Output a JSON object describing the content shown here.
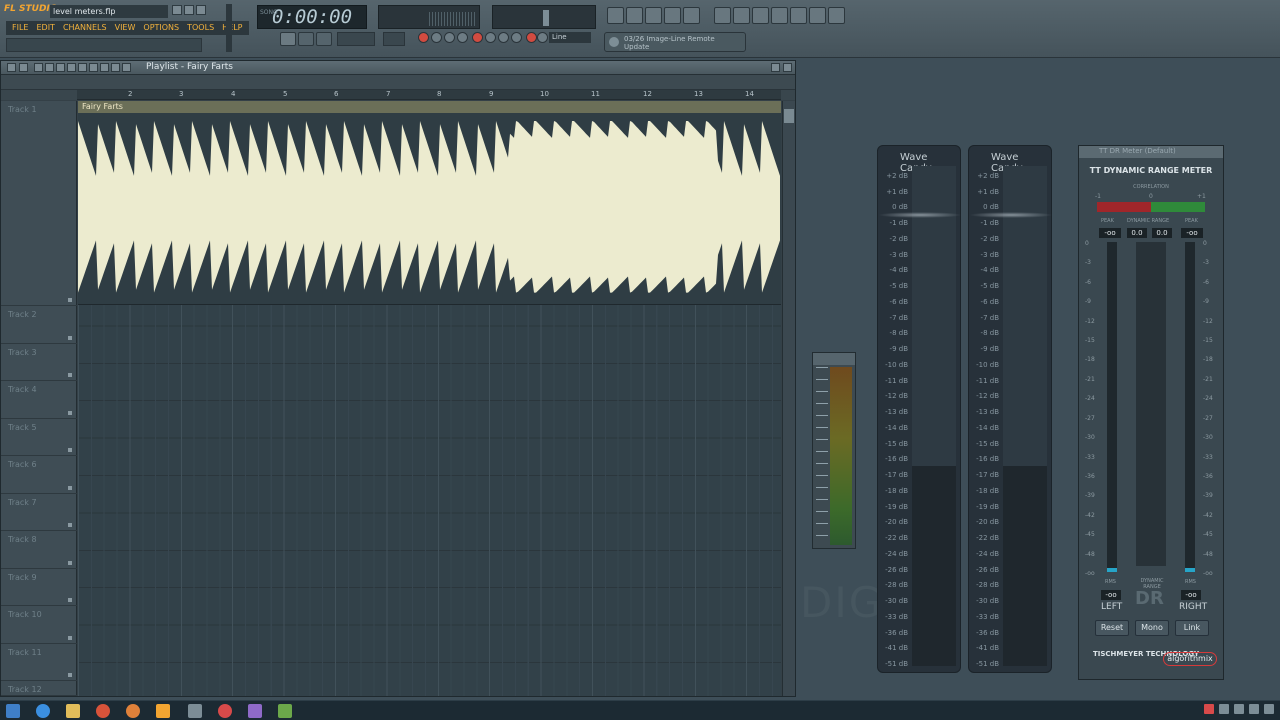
{
  "app": {
    "logo": "FL STUDIO",
    "file_title": "level meters.flp"
  },
  "menu": [
    "FILE",
    "EDIT",
    "CHANNELS",
    "VIEW",
    "OPTIONS",
    "TOOLS",
    "HELP"
  ],
  "transport": {
    "time": "0:00:00",
    "time_prefix": "SONG"
  },
  "toolbar": {
    "line_label": "Line",
    "hint_line1": "03/26 Image-Line Remote",
    "hint_line2": "Update"
  },
  "playlist": {
    "title": "Playlist - Fairy Farts",
    "ruler": [
      "2",
      "3",
      "4",
      "5",
      "6",
      "7",
      "8",
      "9",
      "10",
      "11",
      "12",
      "13",
      "14"
    ],
    "tracks": [
      "Track 1",
      "Track 2",
      "Track 3",
      "Track 4",
      "Track 5",
      "Track 6",
      "Track 7",
      "Track 8",
      "Track 9",
      "Track 10",
      "Track 11",
      "Track 12"
    ],
    "clip_label": "Fairy Farts"
  },
  "wave_candy": {
    "title": "Wave Candy",
    "scale": [
      "+2",
      "+1",
      "0",
      "-1",
      "-2",
      "-3",
      "-4",
      "-5",
      "-6",
      "-7",
      "-8",
      "-9",
      "-10",
      "-11",
      "-12",
      "-13",
      "-14",
      "-15",
      "-16",
      "-17",
      "-18",
      "-19",
      "-20",
      "-22",
      "-24",
      "-26",
      "-28",
      "-30",
      "-33",
      "-36",
      "-41",
      "-51"
    ],
    "unit": "dB"
  },
  "tt_dr": {
    "window_title": "TT DR Meter (Default)",
    "title": "TT DYNAMIC RANGE METER",
    "correlation_label": "CORRELATION",
    "corr_min": "-1",
    "corr_mid": "0",
    "corr_max": "+1",
    "peak_label": "PEAK",
    "dr_label": "DYNAMIC RANGE",
    "peak_left": "-oo",
    "dr_value": "0.0",
    "dr_value2": "0.0",
    "peak_right": "-oo",
    "scale": [
      "0",
      "-3",
      "-6",
      "-9",
      "-12",
      "-15",
      "-18",
      "-21",
      "-24",
      "-27",
      "-30",
      "-33",
      "-36",
      "-39",
      "-42",
      "-45",
      "-48",
      "-oo"
    ],
    "rms_label": "RMS",
    "rms_left": "-oo",
    "rms_right": "-oo",
    "dr_big": "DR",
    "dr_sub": "DYNAMIC RANGE",
    "left_label": "LEFT",
    "right_label": "RIGHT",
    "reset": "Reset",
    "mono": "Mono",
    "link": "Link",
    "brand1": "TISCHMEYER TECHNOLOGY",
    "brand2": "algorithmix"
  },
  "background_text": "DIG"
}
